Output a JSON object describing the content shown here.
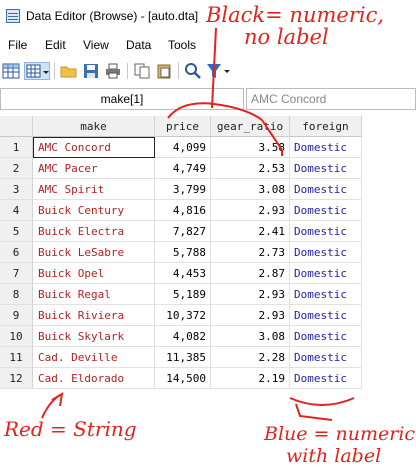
{
  "window": {
    "title": "Data Editor (Browse) - [auto.dta]"
  },
  "menu": [
    "File",
    "Edit",
    "View",
    "Data",
    "Tools"
  ],
  "toolbar_icons": [
    "spreadsheet-icon",
    "filter-grid-icon",
    "open-folder-icon",
    "save-icon",
    "print-icon",
    "copy-icon",
    "paste-icon",
    "find-icon",
    "filter-icon"
  ],
  "editbar": {
    "cell_ref": "make[1]",
    "cell_value": "AMC Concord"
  },
  "grid": {
    "columns": [
      "make",
      "price",
      "gear_ratio",
      "foreign"
    ],
    "rows": [
      {
        "n": "1",
        "make": "AMC Concord",
        "price": "4,099",
        "gear_ratio": "3.58",
        "foreign": "Domestic"
      },
      {
        "n": "2",
        "make": "AMC Pacer",
        "price": "4,749",
        "gear_ratio": "2.53",
        "foreign": "Domestic"
      },
      {
        "n": "3",
        "make": "AMC Spirit",
        "price": "3,799",
        "gear_ratio": "3.08",
        "foreign": "Domestic"
      },
      {
        "n": "4",
        "make": "Buick Century",
        "price": "4,816",
        "gear_ratio": "2.93",
        "foreign": "Domestic"
      },
      {
        "n": "5",
        "make": "Buick Electra",
        "price": "7,827",
        "gear_ratio": "2.41",
        "foreign": "Domestic"
      },
      {
        "n": "6",
        "make": "Buick LeSabre",
        "price": "5,788",
        "gear_ratio": "2.73",
        "foreign": "Domestic"
      },
      {
        "n": "7",
        "make": "Buick Opel",
        "price": "4,453",
        "gear_ratio": "2.87",
        "foreign": "Domestic"
      },
      {
        "n": "8",
        "make": "Buick Regal",
        "price": "5,189",
        "gear_ratio": "2.93",
        "foreign": "Domestic"
      },
      {
        "n": "9",
        "make": "Buick Riviera",
        "price": "10,372",
        "gear_ratio": "2.93",
        "foreign": "Domestic"
      },
      {
        "n": "10",
        "make": "Buick Skylark",
        "price": "4,082",
        "gear_ratio": "3.08",
        "foreign": "Domestic"
      },
      {
        "n": "11",
        "make": "Cad. Deville",
        "price": "11,385",
        "gear_ratio": "2.28",
        "foreign": "Domestic"
      },
      {
        "n": "12",
        "make": "Cad. Eldorado",
        "price": "14,500",
        "gear_ratio": "2.19",
        "foreign": "Domestic"
      }
    ]
  },
  "annotations": {
    "black_line1": "Black= numeric,",
    "black_line2": "no label",
    "red": "Red = String",
    "blue_line1": "Blue = numeric",
    "blue_line2": "with label"
  },
  "colors": {
    "string_text": "#b22222",
    "labeled_text": "#1f1fa8",
    "annotation": "#e3231e"
  }
}
